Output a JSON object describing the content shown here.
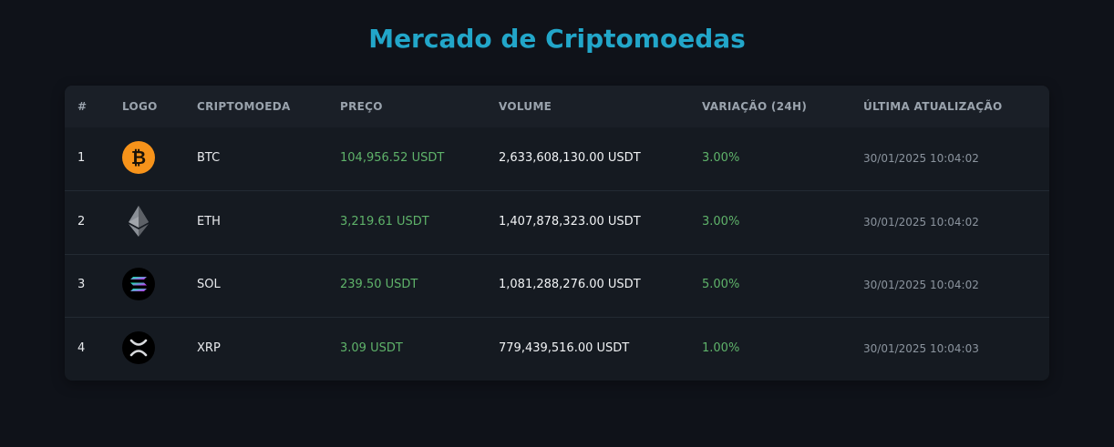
{
  "page": {
    "title": "Mercado de Criptomoedas",
    "accent_color": "#22a6c9",
    "positive_color": "#5fb36a"
  },
  "table": {
    "columns": [
      "#",
      "LOGO",
      "CRIPTOMOEDA",
      "PREÇO",
      "VOLUME",
      "VARIAÇÃO (24H)",
      "ÚLTIMA ATUALIZAÇÃO"
    ],
    "rows": [
      {
        "rank": "1",
        "logo_icon": "bitcoin-icon",
        "symbol": "BTC",
        "price": "104,956.52 USDT",
        "volume": "2,633,608,130.00 USDT",
        "change": "3.00%",
        "updated": "30/01/2025 10:04:02"
      },
      {
        "rank": "2",
        "logo_icon": "ethereum-icon",
        "symbol": "ETH",
        "price": "3,219.61 USDT",
        "volume": "1,407,878,323.00 USDT",
        "change": "3.00%",
        "updated": "30/01/2025 10:04:02"
      },
      {
        "rank": "3",
        "logo_icon": "solana-icon",
        "symbol": "SOL",
        "price": "239.50 USDT",
        "volume": "1,081,288,276.00 USDT",
        "change": "5.00%",
        "updated": "30/01/2025 10:04:02"
      },
      {
        "rank": "4",
        "logo_icon": "xrp-icon",
        "symbol": "XRP",
        "price": "3.09 USDT",
        "volume": "779,439,516.00 USDT",
        "change": "1.00%",
        "updated": "30/01/2025 10:04:03"
      }
    ]
  }
}
